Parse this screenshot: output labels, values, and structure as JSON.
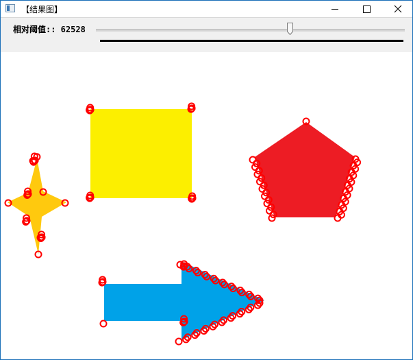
{
  "window": {
    "title": "【结果图】",
    "minimize_icon": "minimize-icon",
    "maximize_icon": "maximize-icon",
    "close_icon": "close-icon"
  },
  "toolbar": {
    "threshold_label": "相对阈值:: 62528",
    "slider_value": 62528
  },
  "canvas": {
    "shapes": [
      {
        "name": "yellow-square",
        "color": "#fcef00"
      },
      {
        "name": "red-pentagon",
        "color": "#ed1c24"
      },
      {
        "name": "gold-star",
        "color": "#ffc90e"
      },
      {
        "name": "blue-arrow",
        "color": "#00a2e8"
      }
    ],
    "marker_color": "#ff0000"
  }
}
